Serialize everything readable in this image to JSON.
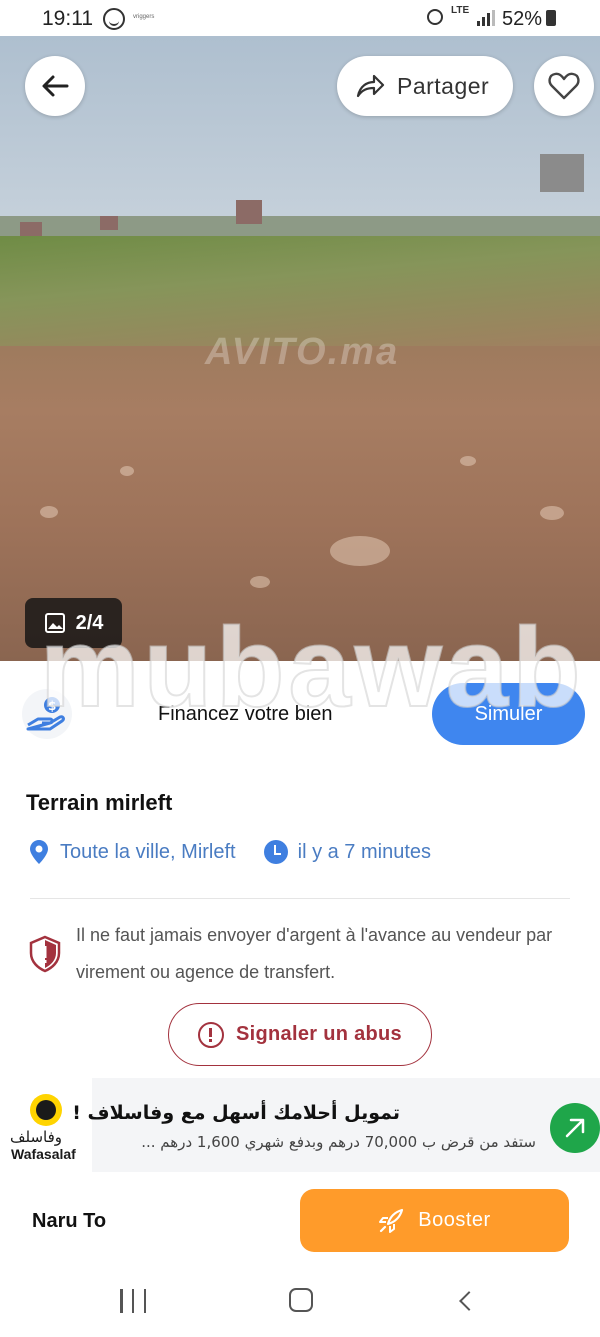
{
  "status_bar": {
    "time": "19:11",
    "tiny_label": "vriggers",
    "network": "LTE",
    "battery": "52%"
  },
  "gallery": {
    "counter": "2/4",
    "watermark": "AVITO.ma",
    "share_label": "Partager"
  },
  "finance": {
    "label": "Financez votre bien",
    "button": "Simuler",
    "overlay_watermark": "mubawab"
  },
  "listing": {
    "title": "Terrain mirleft",
    "location": "Toute la ville, Mirleft",
    "time_ago": "il y a 7 minutes",
    "warning": "Il ne faut jamais envoyer d'argent à l'avance au vendeur par virement ou agence de transfert.",
    "report_button": "Signaler un abus"
  },
  "ad": {
    "logo_arabic": "وفاسلف",
    "logo_latin": "Wafasalaf",
    "title": "تمويل أحلامك أسهل  مع وفاسلاف !",
    "subtitle": "ستفد من قرض ب 70,000 درهم وبدفع شهري 1,600 درهم ..."
  },
  "bottom_bar": {
    "seller": "Naru To",
    "booster_button": "Booster"
  },
  "colors": {
    "accent_blue": "#3f86ef",
    "report_red": "#a3323e",
    "booster_orange": "#ff9b2a",
    "ad_green": "#1fa64a"
  },
  "icons": [
    "back-arrow-icon",
    "share-icon",
    "heart-icon",
    "image-icon",
    "finance-hand-icon",
    "location-pin-icon",
    "clock-icon",
    "shield-icon",
    "alert-icon",
    "rocket-icon",
    "arrow-up-right-icon"
  ]
}
